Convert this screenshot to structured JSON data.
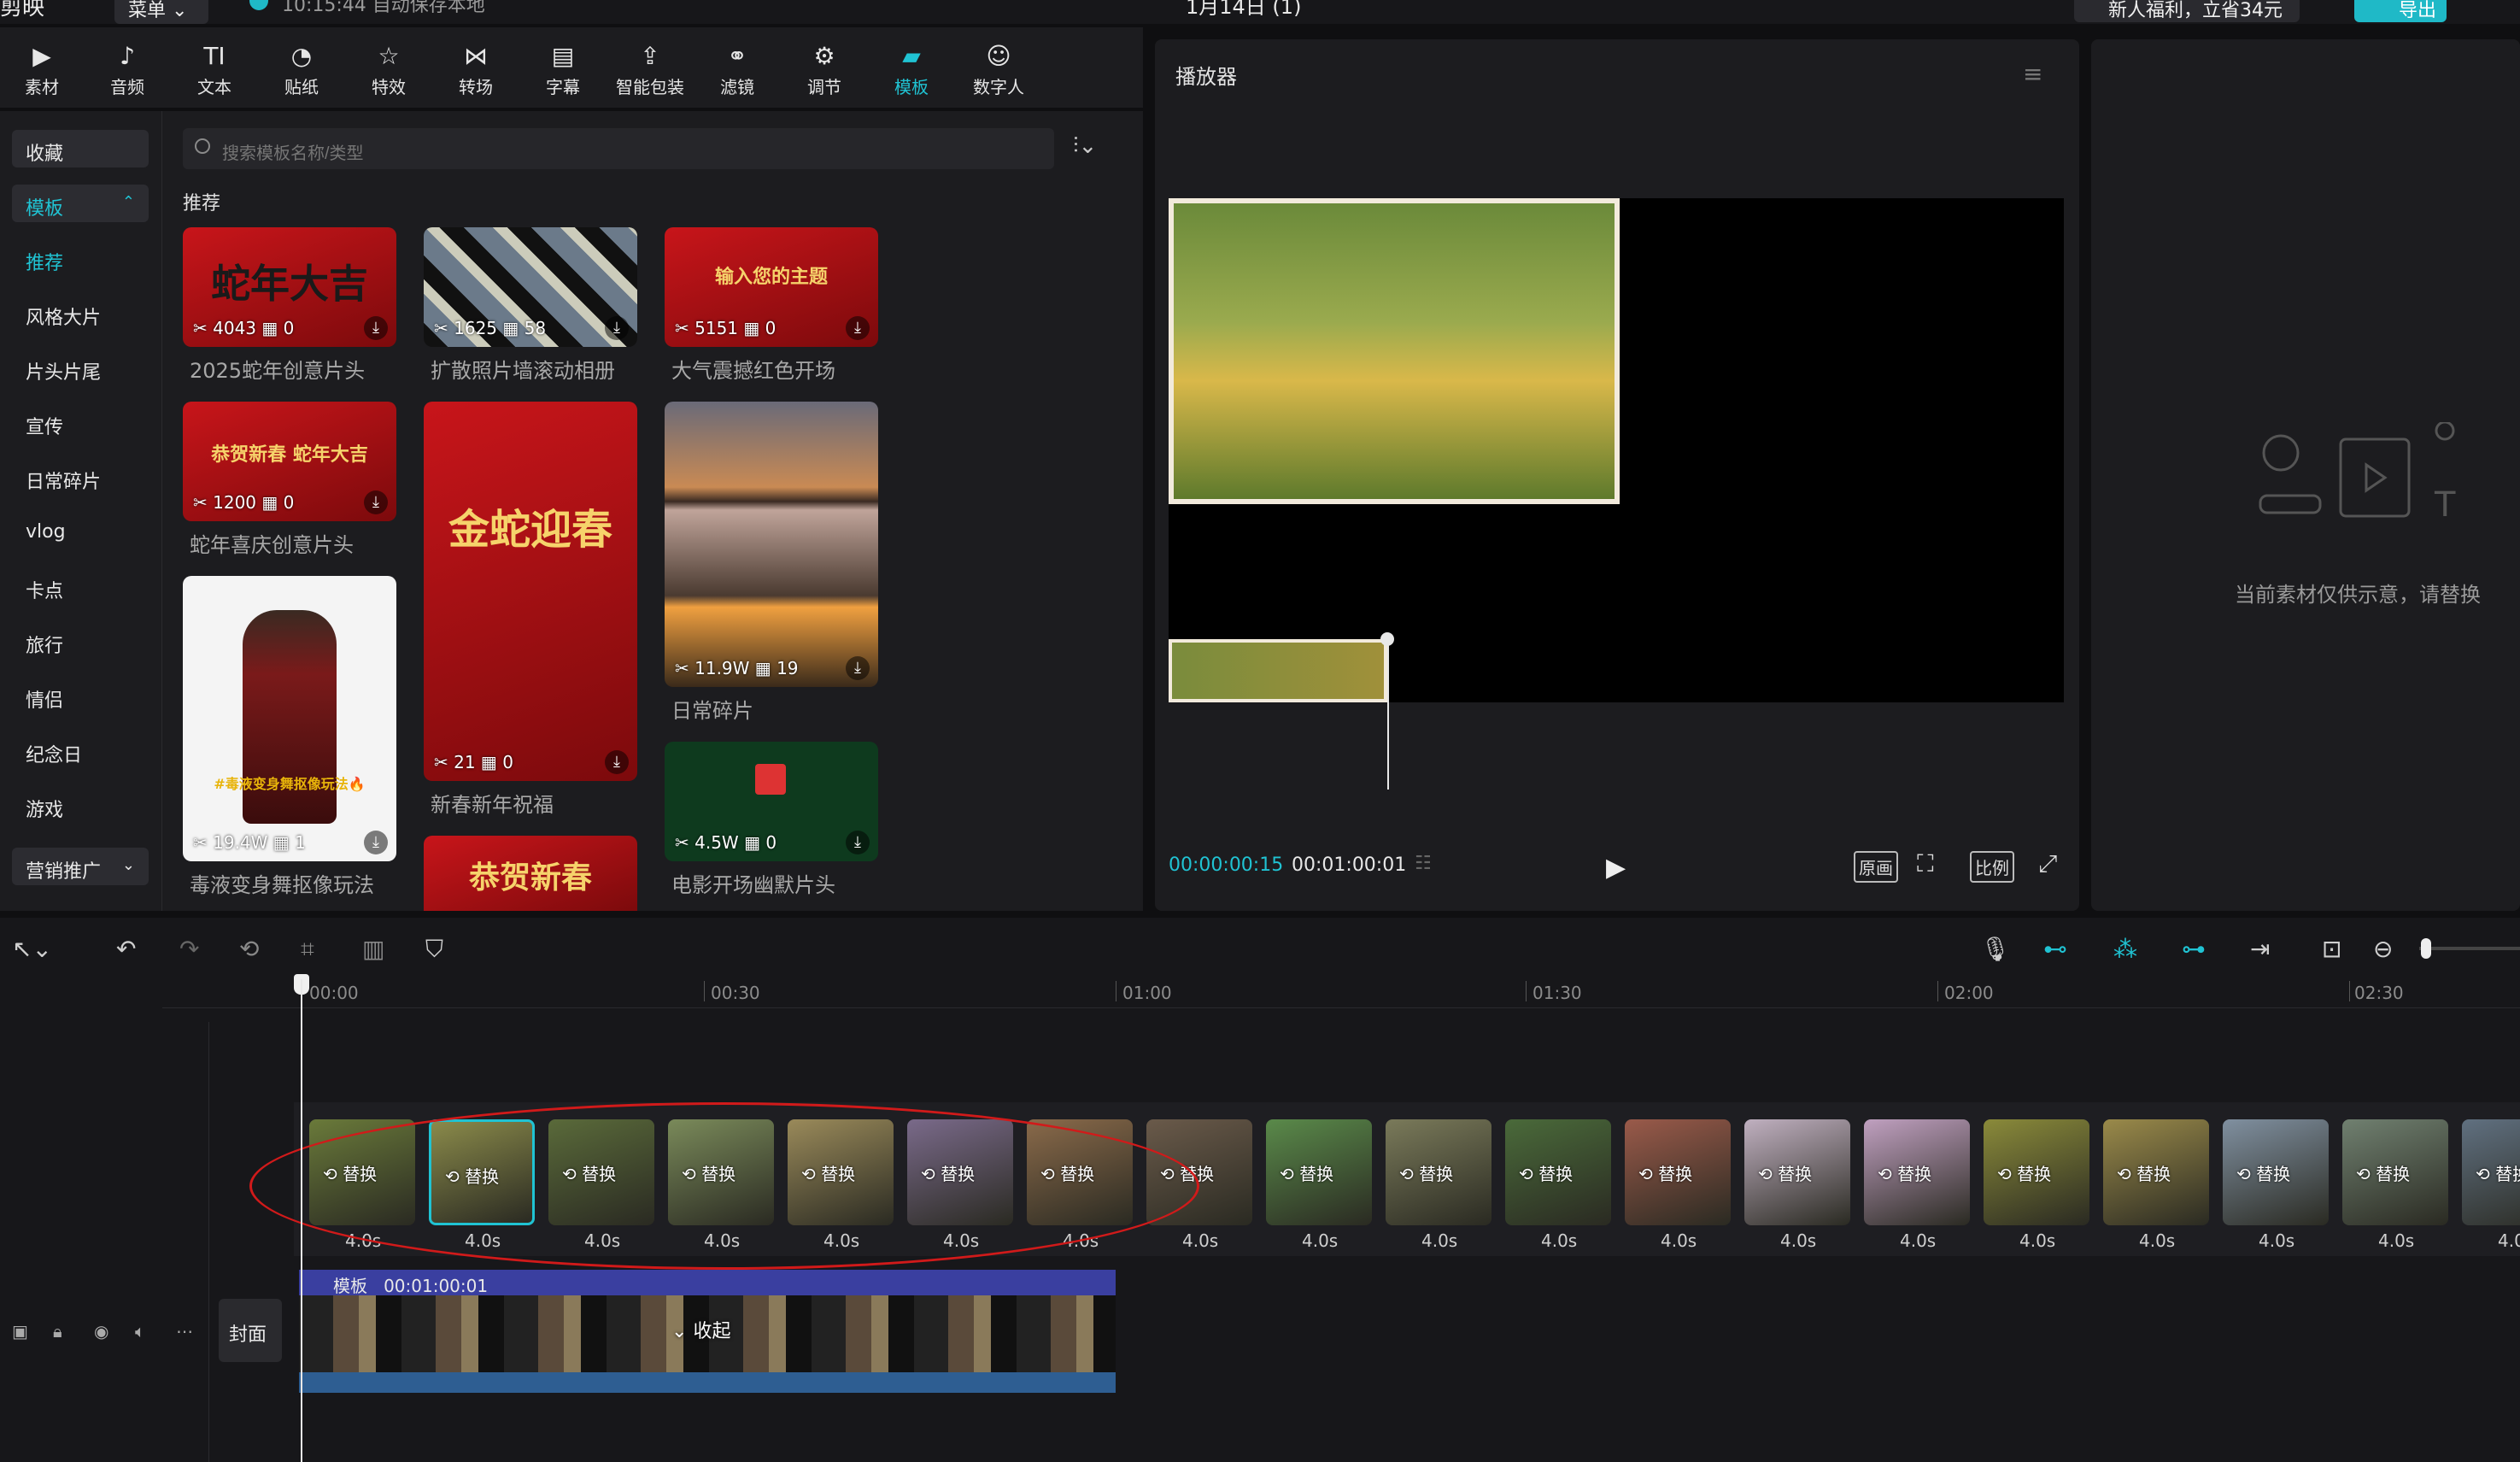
{
  "titlebar": {
    "app_name": "剪映",
    "menu_label": "菜单",
    "save_status": "10:15:44 自动保存本地",
    "doc_title": "1月14日 (1)",
    "promo": "新人福利，立省34元",
    "export_label": "导出"
  },
  "toolbar": [
    {
      "label": "素材",
      "icon": "media-icon"
    },
    {
      "label": "音频",
      "icon": "audio-icon"
    },
    {
      "label": "文本",
      "icon": "text-icon"
    },
    {
      "label": "贴纸",
      "icon": "sticker-icon"
    },
    {
      "label": "特效",
      "icon": "effects-icon"
    },
    {
      "label": "转场",
      "icon": "transition-icon"
    },
    {
      "label": "字幕",
      "icon": "subtitle-icon"
    },
    {
      "label": "智能包装",
      "icon": "smart-pack-icon"
    },
    {
      "label": "滤镜",
      "icon": "filter-icon"
    },
    {
      "label": "调节",
      "icon": "adjust-icon"
    },
    {
      "label": "模板",
      "icon": "template-icon",
      "active": true
    },
    {
      "label": "数字人",
      "icon": "avatar-icon"
    }
  ],
  "sidebar": {
    "collect": "收藏",
    "templates": "模板",
    "marketing": "营销推广",
    "items": [
      "推荐",
      "风格大片",
      "片头片尾",
      "宣传",
      "日常碎片",
      "vlog",
      "卡点",
      "旅行",
      "情侣",
      "纪念日",
      "游戏"
    ]
  },
  "search": {
    "placeholder": "搜索模板名称/类型"
  },
  "section_title": "推荐",
  "cards": [
    {
      "title": "2025蛇年创意片头",
      "uses": "4043",
      "clips": "0",
      "art": "蛇年大吉"
    },
    {
      "title": "扩散照片墙滚动相册",
      "uses": "1625",
      "clips": "58"
    },
    {
      "title": "大气震撼红色开场",
      "uses": "5151",
      "clips": "0",
      "art": "输入您的主题"
    },
    {
      "title": "蛇年喜庆创意片头",
      "uses": "1200",
      "clips": "0",
      "art": "恭贺新春 蛇年大吉"
    },
    {
      "title": "新春新年祝福",
      "uses": "21",
      "clips": "0",
      "art": "金蛇迎春"
    },
    {
      "title": "日常碎片",
      "uses": "11.9W",
      "clips": "19"
    },
    {
      "title": "毒液变身舞抠像玩法",
      "uses": "19.4W",
      "clips": "1",
      "art": "#毒液变身舞抠像玩法🔥"
    },
    {
      "title": "电影开场幽默片头",
      "uses": "4.5W",
      "clips": "0"
    },
    {
      "title": "",
      "uses": "",
      "clips": "",
      "art": "恭贺新春"
    }
  ],
  "player": {
    "title": "播放器",
    "current_time": "00:00:00:15",
    "total_time": "00:01:00:01",
    "btn_original": "原画",
    "btn_ratio": "比例"
  },
  "right_panel": {
    "note": "当前素材仅供示意，请替换"
  },
  "timeline": {
    "ruler": [
      "00:00",
      "00:30",
      "01:00",
      "01:30",
      "02:00",
      "02:30"
    ],
    "replace_label": "替换",
    "clip_duration": "4.0s",
    "clip_count": 19,
    "cover_label": "封面",
    "template_label": "模板",
    "template_duration": "00:01:00:01",
    "collapse_label": "收起"
  }
}
